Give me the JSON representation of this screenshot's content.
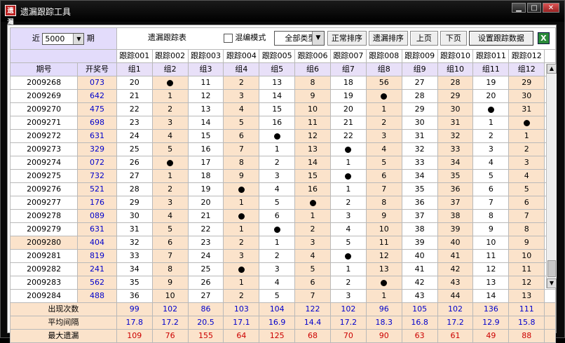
{
  "window": {
    "title": "遗漏跟踪工具",
    "icon_text": "遗漏",
    "buttons": [
      "minimize",
      "maximize",
      "close"
    ]
  },
  "period_selector": {
    "prefix": "近",
    "value": "5000",
    "suffix": "期"
  },
  "toolbar": {
    "table_title": "遗漏跟踪表",
    "mixed_mode_label": "混编模式",
    "mixed_mode_checked": false,
    "type_select": "全部类型",
    "normal_sort": "正常排序",
    "miss_sort": "遗漏排序",
    "prev_page": "上页",
    "next_page": "下页",
    "settings": "设置跟踪数据",
    "excel_icon": "excel-export-icon"
  },
  "columns": {
    "period_header": "期号",
    "winning_header": "开奖号",
    "trackers": [
      "跟踪001",
      "跟踪002",
      "跟踪003",
      "跟踪004",
      "跟踪005",
      "跟踪006",
      "跟踪007",
      "跟踪008",
      "跟踪009",
      "跟踪010",
      "跟踪011",
      "跟踪012"
    ],
    "groups": [
      "组1",
      "组2",
      "组3",
      "组4",
      "组5",
      "组6",
      "组7",
      "组8",
      "组9",
      "组10",
      "组11",
      "组12"
    ]
  },
  "rows": [
    {
      "period": "2009268",
      "number": "073",
      "values": [
        "20",
        "●",
        "11",
        "2",
        "13",
        "8",
        "18",
        "56",
        "27",
        "28",
        "19",
        "29"
      ]
    },
    {
      "period": "2009269",
      "number": "642",
      "values": [
        "21",
        "1",
        "12",
        "3",
        "14",
        "9",
        "19",
        "●",
        "28",
        "29",
        "20",
        "30"
      ]
    },
    {
      "period": "2009270",
      "number": "475",
      "values": [
        "22",
        "2",
        "13",
        "4",
        "15",
        "10",
        "20",
        "1",
        "29",
        "30",
        "●",
        "31"
      ]
    },
    {
      "period": "2009271",
      "number": "698",
      "values": [
        "23",
        "3",
        "14",
        "5",
        "16",
        "11",
        "21",
        "2",
        "30",
        "31",
        "1",
        "●"
      ]
    },
    {
      "period": "2009272",
      "number": "631",
      "values": [
        "24",
        "4",
        "15",
        "6",
        "●",
        "12",
        "22",
        "3",
        "31",
        "32",
        "2",
        "1"
      ]
    },
    {
      "period": "2009273",
      "number": "329",
      "values": [
        "25",
        "5",
        "16",
        "7",
        "1",
        "13",
        "●",
        "4",
        "32",
        "33",
        "3",
        "2"
      ]
    },
    {
      "period": "2009274",
      "number": "072",
      "values": [
        "26",
        "●",
        "17",
        "8",
        "2",
        "14",
        "1",
        "5",
        "33",
        "34",
        "4",
        "3"
      ]
    },
    {
      "period": "2009275",
      "number": "732",
      "values": [
        "27",
        "1",
        "18",
        "9",
        "3",
        "15",
        "●",
        "6",
        "34",
        "35",
        "5",
        "4"
      ]
    },
    {
      "period": "2009276",
      "number": "521",
      "values": [
        "28",
        "2",
        "19",
        "●",
        "4",
        "16",
        "1",
        "7",
        "35",
        "36",
        "6",
        "5"
      ]
    },
    {
      "period": "2009277",
      "number": "176",
      "values": [
        "29",
        "3",
        "20",
        "1",
        "5",
        "●",
        "2",
        "8",
        "36",
        "37",
        "7",
        "6"
      ]
    },
    {
      "period": "2009278",
      "number": "089",
      "values": [
        "30",
        "4",
        "21",
        "●",
        "6",
        "1",
        "3",
        "9",
        "37",
        "38",
        "8",
        "7"
      ]
    },
    {
      "period": "2009279",
      "number": "631",
      "values": [
        "31",
        "5",
        "22",
        "1",
        "●",
        "2",
        "4",
        "10",
        "38",
        "39",
        "9",
        "8"
      ]
    },
    {
      "period": "2009280",
      "number": "404",
      "values": [
        "32",
        "6",
        "23",
        "2",
        "1",
        "3",
        "5",
        "11",
        "39",
        "40",
        "10",
        "9"
      ]
    },
    {
      "period": "2009281",
      "number": "819",
      "values": [
        "33",
        "7",
        "24",
        "3",
        "2",
        "4",
        "●",
        "12",
        "40",
        "41",
        "11",
        "10"
      ]
    },
    {
      "period": "2009282",
      "number": "241",
      "values": [
        "34",
        "8",
        "25",
        "●",
        "3",
        "5",
        "1",
        "13",
        "41",
        "42",
        "12",
        "11"
      ]
    },
    {
      "period": "2009283",
      "number": "562",
      "values": [
        "35",
        "9",
        "26",
        "1",
        "4",
        "6",
        "2",
        "●",
        "42",
        "43",
        "13",
        "12"
      ]
    },
    {
      "period": "2009284",
      "number": "488",
      "values": [
        "36",
        "10",
        "27",
        "2",
        "5",
        "7",
        "3",
        "1",
        "43",
        "44",
        "14",
        "13"
      ]
    }
  ],
  "stats": [
    {
      "label": "出现次数",
      "values": [
        "99",
        "102",
        "86",
        "103",
        "104",
        "122",
        "102",
        "96",
        "105",
        "102",
        "136",
        "111"
      ],
      "color": "#0000cc"
    },
    {
      "label": "平均间隔",
      "values": [
        "17.8",
        "17.2",
        "20.5",
        "17.1",
        "16.9",
        "14.4",
        "17.2",
        "18.3",
        "16.8",
        "17.2",
        "12.9",
        "15.8"
      ],
      "color": "#0000cc"
    },
    {
      "label": "最大遗漏",
      "values": [
        "109",
        "76",
        "155",
        "64",
        "125",
        "68",
        "70",
        "90",
        "63",
        "61",
        "49",
        "88"
      ],
      "color": "#cc0000"
    }
  ],
  "colors": {
    "header_bg": "#e3dcfb",
    "peach": "#fbe3cb",
    "number_blue": "#0000cc",
    "stat_red": "#cc0000"
  }
}
